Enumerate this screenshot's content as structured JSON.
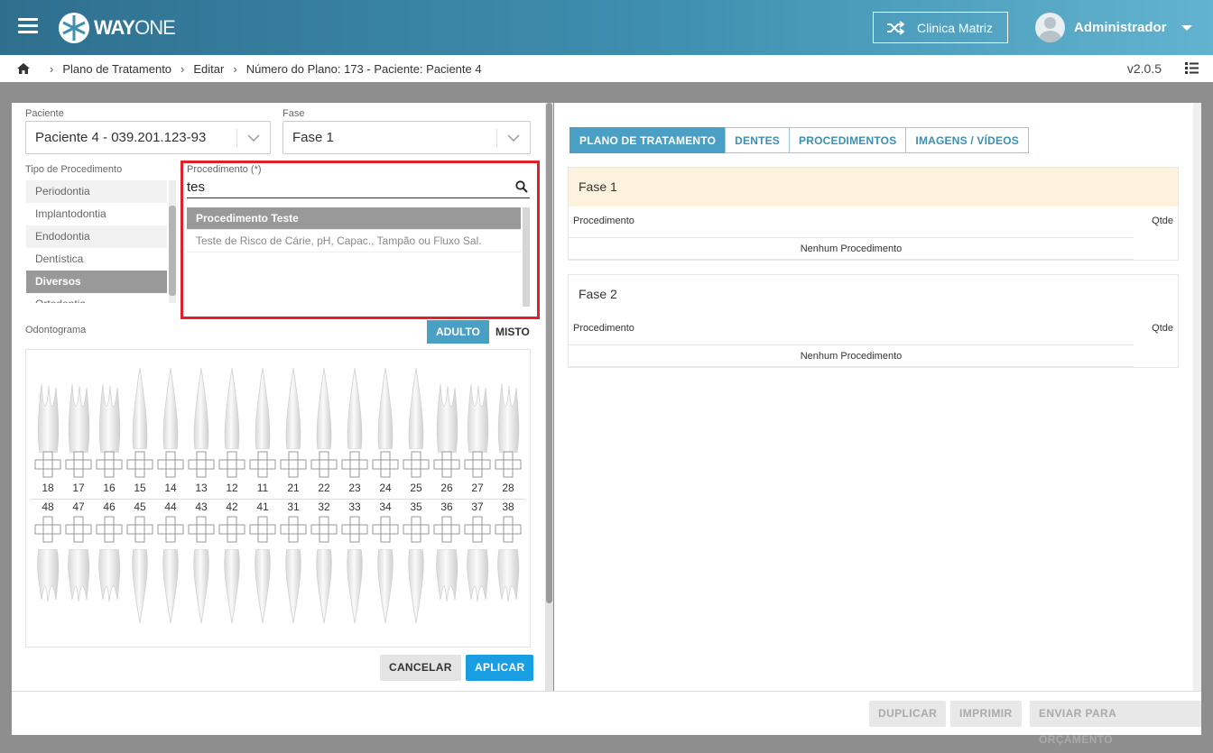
{
  "header": {
    "logo_text_bold": "WAY",
    "logo_text_light": "ONE",
    "clinic_button": "Clinica Matriz",
    "user_name": "Administrador"
  },
  "breadcrumb": {
    "items": [
      "Plano de Tratamento",
      "Editar",
      "Número do Plano: 173 - Paciente: Paciente 4"
    ],
    "version": "v2.0.5"
  },
  "form": {
    "patient_label": "Paciente",
    "patient_value": "Paciente 4 - 039.201.123-93",
    "phase_label": "Fase",
    "phase_value": "Fase 1",
    "proc_type_label": "Tipo de Procedimento",
    "proc_types": [
      "Periodontia",
      "Implantodontia",
      "Endodontia",
      "Dentística",
      "Diversos",
      "Ortodontia"
    ],
    "proc_types_active": "Diversos",
    "procedure_label": "Procedimento (*)",
    "search_value": "tes",
    "results": [
      "Procedimento Teste",
      "Teste de Risco de Cárie, pH, Capac., Tampão ou Fluxo Sal."
    ]
  },
  "odontogram": {
    "label": "Odontograma",
    "toggle_adult": "ADULTO",
    "toggle_mixed": "MISTO",
    "upper_numbers": [
      "18",
      "17",
      "16",
      "15",
      "14",
      "13",
      "12",
      "11",
      "21",
      "22",
      "23",
      "24",
      "25",
      "26",
      "27",
      "28"
    ],
    "lower_numbers": [
      "48",
      "47",
      "46",
      "45",
      "44",
      "43",
      "42",
      "41",
      "31",
      "32",
      "33",
      "34",
      "35",
      "36",
      "37",
      "38"
    ]
  },
  "actions": {
    "cancel": "CANCELAR",
    "apply": "APLICAR"
  },
  "plan": {
    "tabs": [
      "PLANO DE TRATAMENTO",
      "DENTES",
      "PROCEDIMENTOS",
      "IMAGENS / VÍDEOS"
    ],
    "phases": [
      {
        "title": "Fase 1",
        "col_procedure": "Procedimento",
        "col_qty": "Qtde",
        "empty": "Nenhum Procedimento",
        "color": "#fdf2dd"
      },
      {
        "title": "Fase 2",
        "col_procedure": "Procedimento",
        "col_qty": "Qtde",
        "empty": "Nenhum Procedimento",
        "color": "#ffffff"
      }
    ]
  },
  "footer": {
    "duplicate": "DUPLICAR",
    "print": "IMPRIMIR",
    "send_budget": "ENVIAR PARA ORÇAMENTO"
  },
  "colors": {
    "accent": "#4a9fc4",
    "apply": "#1a9ee3",
    "highlight_box": "#e0202a"
  }
}
